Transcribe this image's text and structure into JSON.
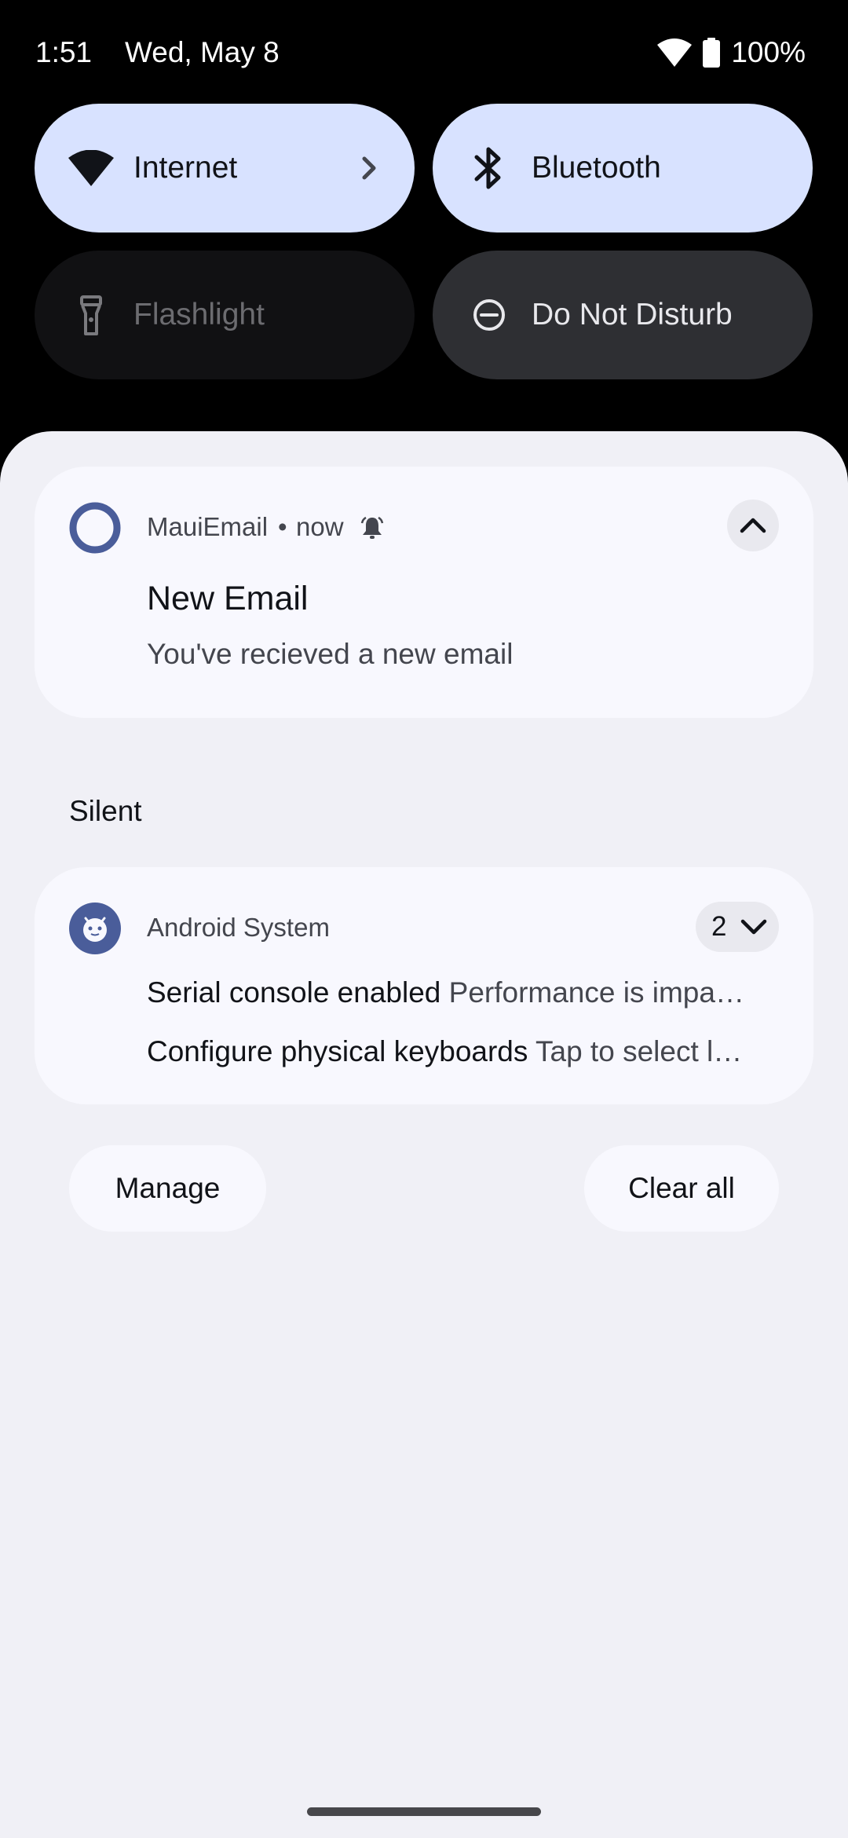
{
  "status_bar": {
    "time": "1:51",
    "date": "Wed, May 8",
    "battery": "100%",
    "wifi_icon": "wifi-icon",
    "battery_icon": "battery-icon"
  },
  "quick_settings": {
    "tiles": [
      {
        "label": "Internet",
        "icon": "wifi-icon",
        "state": "on",
        "has_chevron": true
      },
      {
        "label": "Bluetooth",
        "icon": "bluetooth-icon",
        "state": "on"
      },
      {
        "label": "Flashlight",
        "icon": "flashlight-icon",
        "state": "off"
      },
      {
        "label": "Do Not Disturb",
        "icon": "do-not-disturb-icon",
        "state": "off"
      }
    ]
  },
  "notifications": {
    "mauiemail": {
      "app_name": "MauiEmail",
      "separator": "•",
      "time": "now",
      "title": "New Email",
      "text": "You've recieved a new email",
      "icon": "app-ring-icon",
      "alert_icon": "bell-icon",
      "expand_icon": "chevron-up-icon"
    },
    "silent_header": "Silent",
    "android_system": {
      "app_name": "Android System",
      "count": "2",
      "icon": "android-system-icon",
      "expand_icon": "chevron-down-icon",
      "lines": [
        {
          "title": "Serial console enabled",
          "text": "Performance is impa…"
        },
        {
          "title": "Configure physical keyboards",
          "text": "Tap to select l…"
        }
      ]
    }
  },
  "actions": {
    "manage_label": "Manage",
    "clear_all_label": "Clear all"
  },
  "colors": {
    "tile_on": "#d8e2ff",
    "tile_off": "#111113",
    "tile_dnd": "#2e2f33",
    "shade_bg": "#f0f0f6",
    "card_bg": "#f8f8fe",
    "accent": "#4a5d9a"
  }
}
